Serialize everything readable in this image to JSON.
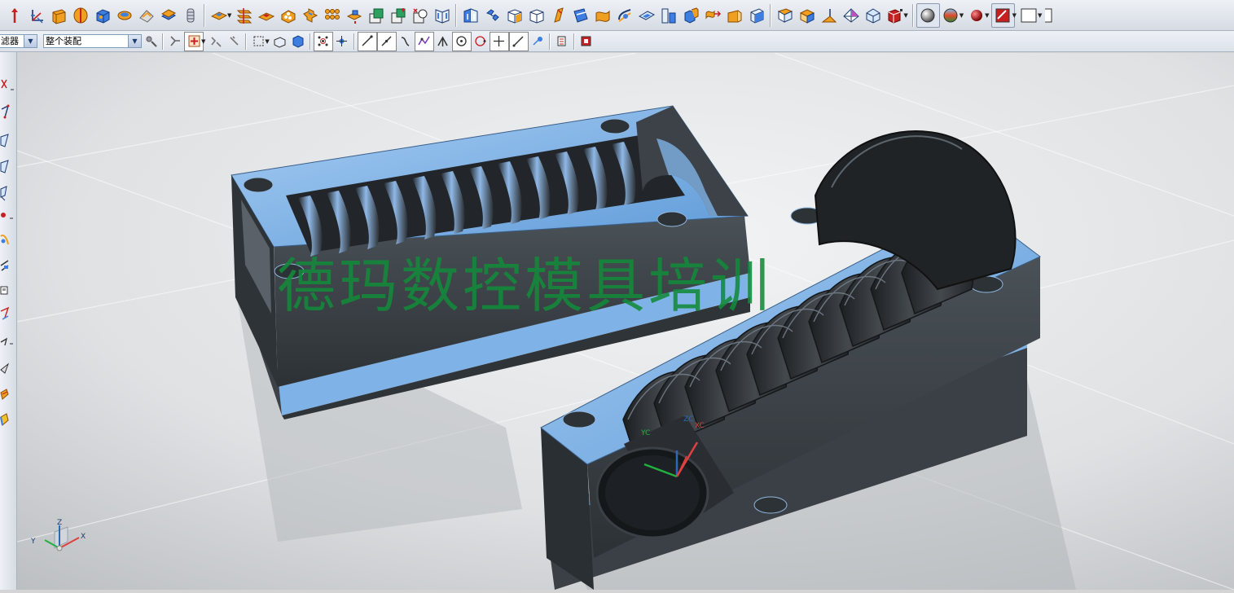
{
  "toolbar_top": {
    "icons": [
      "datum-axis-icon",
      "datum-csys-icon",
      "extrude-icon",
      "revolve-icon",
      "block-icon",
      "cylinder-icon",
      "cone-icon",
      "sphere-icon",
      "tube-icon",
      "unite-icon",
      "subtract-icon",
      "intersect-icon",
      "edge-blend-icon",
      "chamfer-icon",
      "hole-icon",
      "boss-icon",
      "pocket-icon",
      "pad-icon",
      "slot-icon",
      "groove-icon",
      "rib-icon",
      "shell-icon",
      "draft-icon",
      "thicken-icon",
      "offset-face-icon",
      "trim-body-icon",
      "split-body-icon",
      "sew-icon",
      "patch-icon",
      "mirror-icon",
      "pattern-icon",
      "extract-icon",
      "sheet-icon",
      "swept-icon",
      "ruled-icon",
      "through-curves-icon",
      "bounded-plane-icon",
      "n-sided-icon",
      "surface-icon",
      "section-icon",
      "face-icon",
      "replace-face-icon",
      "move-face-icon",
      "wireframe-icon",
      "render-style-icon",
      "shaded-icon",
      "color-icon",
      "material-icon",
      "edit-object-icon",
      "background-icon"
    ]
  },
  "toolbar_second": {
    "filter_label": "选择过滤器",
    "filter_value": "滤器",
    "scope_value": "整个装配",
    "icons": [
      "select-icon",
      "snap-point-icon",
      "quick-pick-icon",
      "box-select-icon",
      "solid-icon",
      "body-icon",
      "end-point-icon",
      "mid-point-icon",
      "control-point-icon",
      "intersection-icon",
      "tangent-icon",
      "arc-center-icon",
      "quadrant-icon",
      "existing-point-icon",
      "point-on-curve-icon",
      "on-surface-icon",
      "grid-icon",
      "stop-icon"
    ]
  },
  "left_toolbar": {
    "icons": [
      "line-icon",
      "arc-icon",
      "plane-icon",
      "curve-icon",
      "spline-icon",
      "point-icon",
      "extrude-side-icon",
      "edit-icon",
      "sketch-icon",
      "offset-curve-icon",
      "project-icon",
      "intersect-curve-icon",
      "rectangle-icon",
      "color-side-icon"
    ]
  },
  "viewport": {
    "watermark": "德玛数控模具培训",
    "triad_labels": {
      "x": "X",
      "y": "Y",
      "z": "Z"
    },
    "csys_labels": {
      "xc": "XC",
      "yc": "YC",
      "zc": "ZC"
    }
  },
  "colors": {
    "mold_blue": "#7fb2e6",
    "mold_dark": "#3c4247",
    "background_light": "#eceeef",
    "background_dark": "#b9bdc0",
    "watermark_green": "#138a3b"
  }
}
